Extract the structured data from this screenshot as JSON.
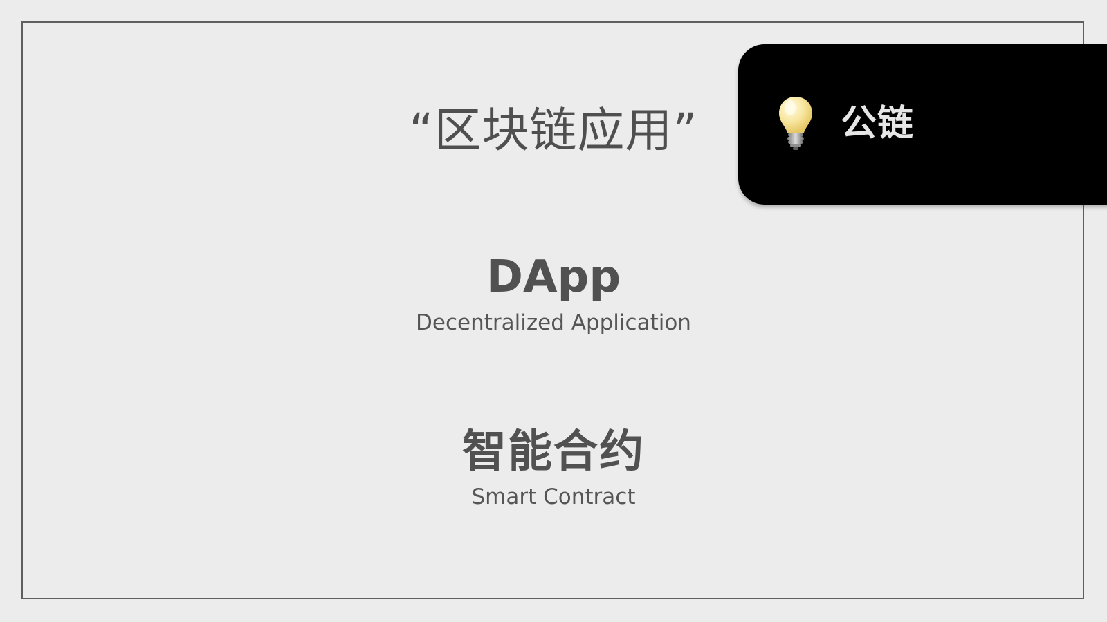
{
  "slide": {
    "title": "“区块链应用”",
    "terms": [
      {
        "main": "DApp",
        "sub": "Decentralized Application"
      },
      {
        "main": "智能合约",
        "sub": "Smart Contract"
      }
    ]
  },
  "callout": {
    "label": "公链",
    "icon": "lightbulb-icon"
  },
  "colors": {
    "background": "#ececec",
    "frame": "#5f5f5f",
    "text": "#515151",
    "callout_bg": "#000000",
    "callout_text": "#e6e6e6",
    "bulb": "#f8e7a1"
  }
}
